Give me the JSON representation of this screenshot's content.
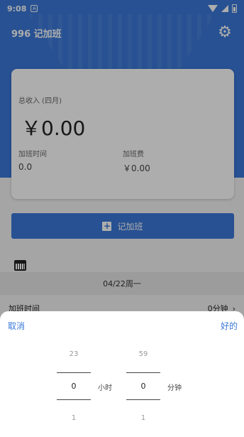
{
  "statusbar": {
    "time": "9:08",
    "notif_letter": "A"
  },
  "app": {
    "title": "996 记加班",
    "settings_icon": "gear-icon"
  },
  "card": {
    "income_label": "总收入 (四月)",
    "income_value": "￥0.00",
    "ot_time_label": "加班时间",
    "ot_time_value": "0.0",
    "ot_fee_label": "加班费",
    "ot_fee_value": "￥0.00"
  },
  "add_button": {
    "label": "记加班",
    "icon": "plus-square-icon"
  },
  "calendar": {
    "icon": "calendar-icon",
    "date": "04/22周一"
  },
  "ot_row": {
    "label": "加班时间",
    "value": "0分钟"
  },
  "sheet": {
    "cancel": "取消",
    "ok": "好的",
    "hours": {
      "prev": "23",
      "current": "0",
      "next": "1",
      "unit": "小时"
    },
    "minutes": {
      "prev": "59",
      "current": "0",
      "next": "1",
      "unit": "分钟"
    }
  },
  "colors": {
    "primary": "#3a78d8",
    "background": "#f4f4f4"
  }
}
